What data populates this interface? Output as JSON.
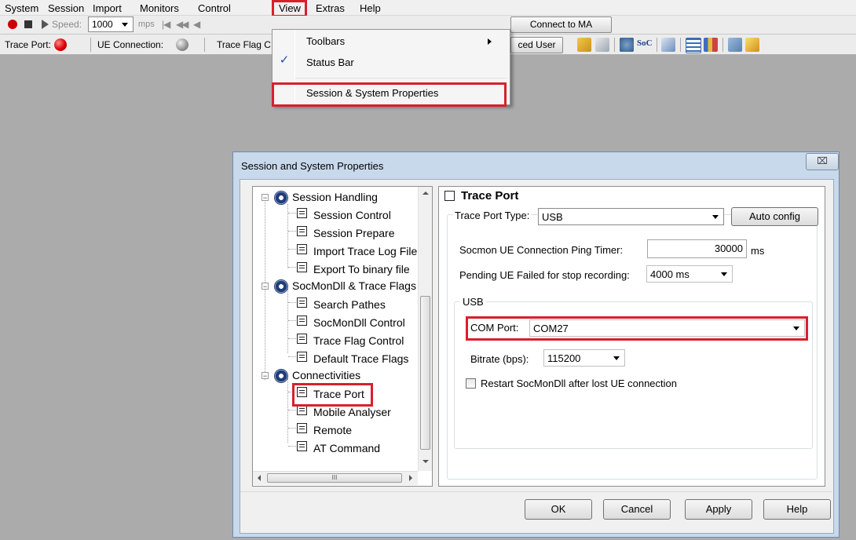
{
  "menubar": {
    "items": [
      "System",
      "Session",
      "Import",
      "Monitors",
      "Control",
      "View",
      "Extras",
      "Help"
    ]
  },
  "toolbar1": {
    "speed_label": "Speed:",
    "speed_value": "1000",
    "mps_label": "mps",
    "connect_button": "Connect to MA"
  },
  "toolbar2": {
    "trace_port_label": "Trace Port:",
    "ue_connection_label": "UE Connection:",
    "trace_flag_label": "Trace Flag C",
    "user_button": "ced User"
  },
  "view_menu": {
    "items": [
      {
        "label": "Toolbars",
        "submenu": true,
        "checked": false
      },
      {
        "label": "Status Bar",
        "submenu": false,
        "checked": true
      },
      {
        "label": "Session & System Properties",
        "submenu": false,
        "checked": false
      }
    ]
  },
  "dialog": {
    "title": "Session and System Properties",
    "close_glyph": "⌧",
    "tree": {
      "groups": [
        {
          "label": "Session Handling",
          "children": [
            "Session Control",
            "Session Prepare",
            "Import Trace Log File",
            "Export To binary file"
          ]
        },
        {
          "label": "SocMonDll & Trace Flags",
          "children": [
            "Search Pathes",
            "SocMonDll Control",
            "Trace Flag Control",
            "Default Trace Flags"
          ]
        },
        {
          "label": "Connectivities",
          "children": [
            "Trace Port",
            "Mobile Analyser",
            "Remote",
            "AT Command"
          ]
        }
      ],
      "selected": "Trace Port",
      "hscroll_thumb": "III"
    },
    "panel": {
      "heading": "Trace Port",
      "trace_port_type_label": "Trace Port Type:",
      "trace_port_type_value": "USB",
      "auto_config_button": "Auto config",
      "ping_timer_label": "Socmon UE Connection Ping Timer:",
      "ping_timer_value": "30000",
      "ping_timer_unit": "ms",
      "pending_label": "Pending UE Failed for stop recording:",
      "pending_value": "4000 ms",
      "usb_group_label": "USB",
      "com_port_label": "COM Port:",
      "com_port_value": "COM27",
      "bitrate_label": "Bitrate (bps):",
      "bitrate_value": "115200",
      "restart_label": "Restart SocMonDll after lost UE connection",
      "restart_checked": false
    },
    "buttons": {
      "ok": "OK",
      "cancel": "Cancel",
      "apply": "Apply",
      "help": "Help"
    }
  },
  "colors": {
    "highlight_box": "#d8202c",
    "dialog_frame": "#c8d9ec",
    "workspace": "#ababab"
  }
}
